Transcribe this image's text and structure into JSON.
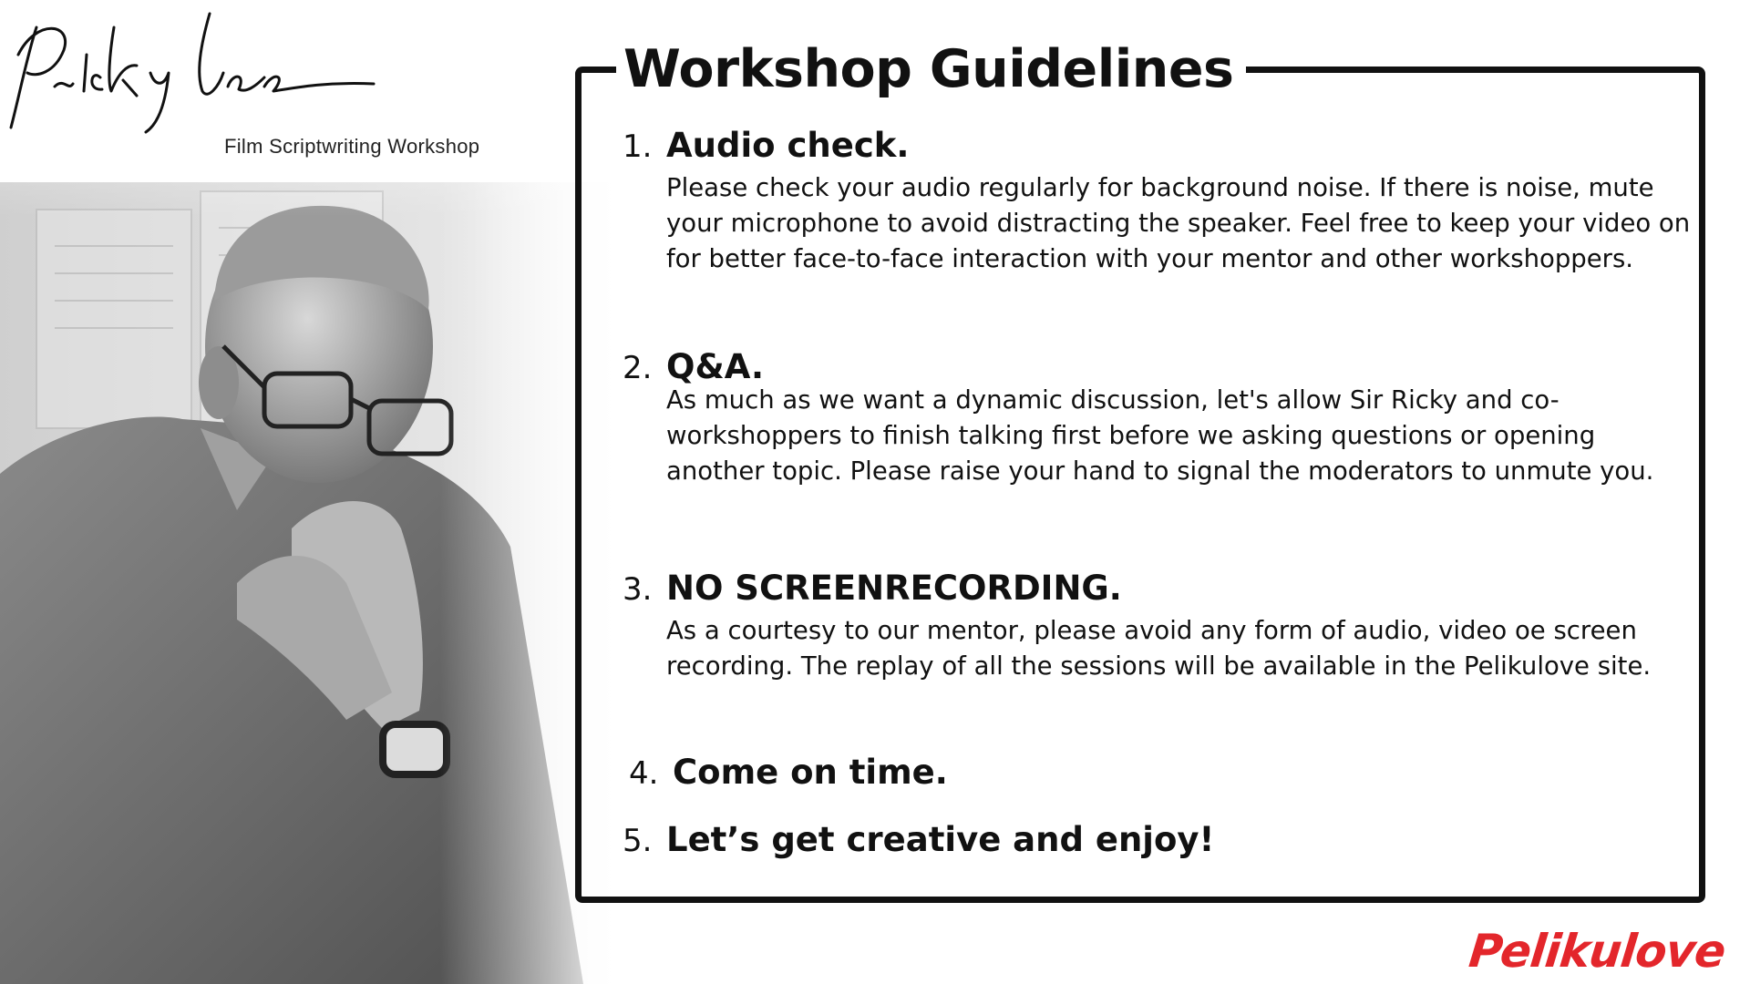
{
  "header": {
    "caption": "Film Scriptwriting Workshop"
  },
  "guidelines": {
    "title": "Workshop Guidelines",
    "items": [
      {
        "number": "1.",
        "title": "Audio check.",
        "body": "Please check your audio regularly for background noise. If there is noise, mute your microphone to avoid distracting the speaker. Feel free to keep your video on for better face-to-face interaction with your mentor and other workshoppers."
      },
      {
        "number": "2.",
        "title": "Q&A.",
        "body": "As much as we want a dynamic discussion, let's allow Sir Ricky and co-workshoppers to finish talking first before we asking questions or opening another topic. Please raise your hand to signal the moderators to unmute you."
      },
      {
        "number": "3.",
        "title": "NO SCREENRECORDING.",
        "body": "As a courtesy to our mentor, please avoid any form of audio, video oe screen recording. The replay of all the sessions will be available in the Pelikulove site."
      },
      {
        "number": "4.",
        "title": "Come on time.",
        "body": ""
      },
      {
        "number": "5.",
        "title": "Let’s get creative and enjoy!",
        "body": ""
      }
    ]
  },
  "brand": {
    "logo_text": "Pelikulove",
    "logo_color": "#e3262b"
  },
  "icons": {
    "signature": "signature-icon",
    "portrait": "portrait-photo"
  }
}
